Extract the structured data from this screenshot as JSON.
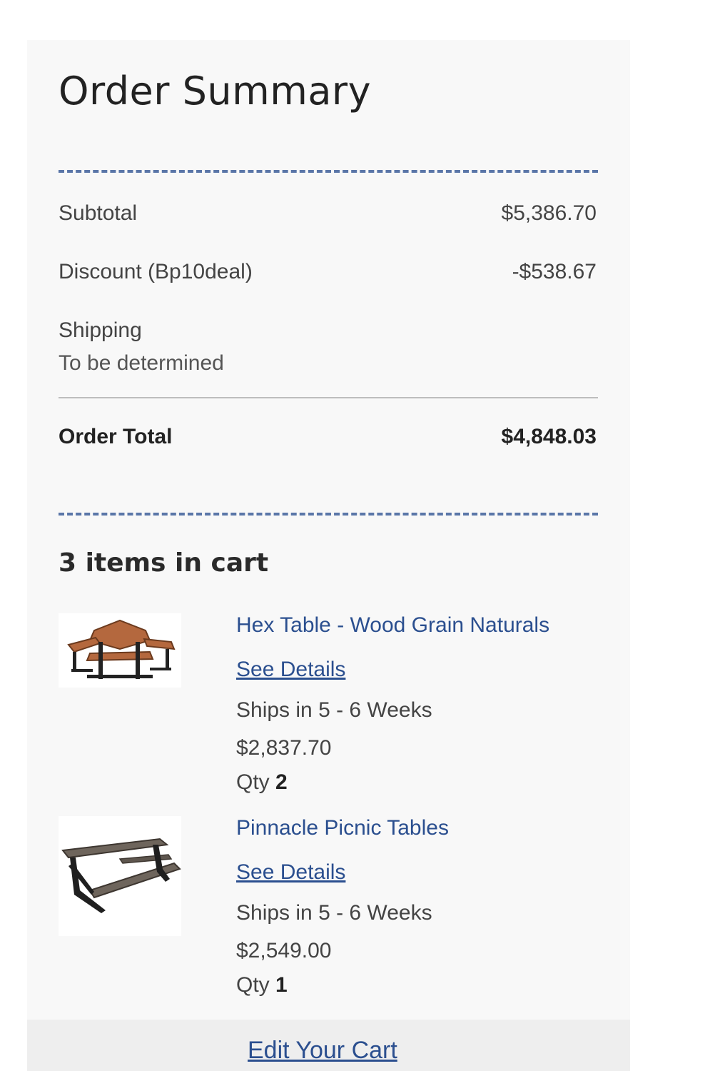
{
  "summary": {
    "title": "Order Summary",
    "subtotal_label": "Subtotal",
    "subtotal_value": "$5,386.70",
    "discount_label": "Discount (Bp10deal)",
    "discount_value": "-$538.67",
    "shipping_label": "Shipping",
    "shipping_value": "To be determined",
    "total_label": "Order Total",
    "total_value": "$4,848.03"
  },
  "cart": {
    "items_count_label": "3 items in cart",
    "items": [
      {
        "name": "Hex Table - Wood Grain Naturals",
        "details_link": "See Details",
        "ships": "Ships in 5 - 6 Weeks",
        "price": "$2,837.70",
        "qty_label": "Qty",
        "qty_value": "2",
        "image_icon": "hex-picnic-table-icon"
      },
      {
        "name": "Pinnacle Picnic Tables",
        "details_link": "See Details",
        "ships": "Ships in 5 - 6 Weeks",
        "price": "$2,549.00",
        "qty_label": "Qty",
        "qty_value": "1",
        "image_icon": "picnic-table-icon"
      }
    ],
    "edit_link": "Edit Your Cart"
  },
  "colors": {
    "link": "#2b4f8f",
    "dashed_rule": "#5a76a8",
    "panel_bg": "#f8f8f8"
  }
}
